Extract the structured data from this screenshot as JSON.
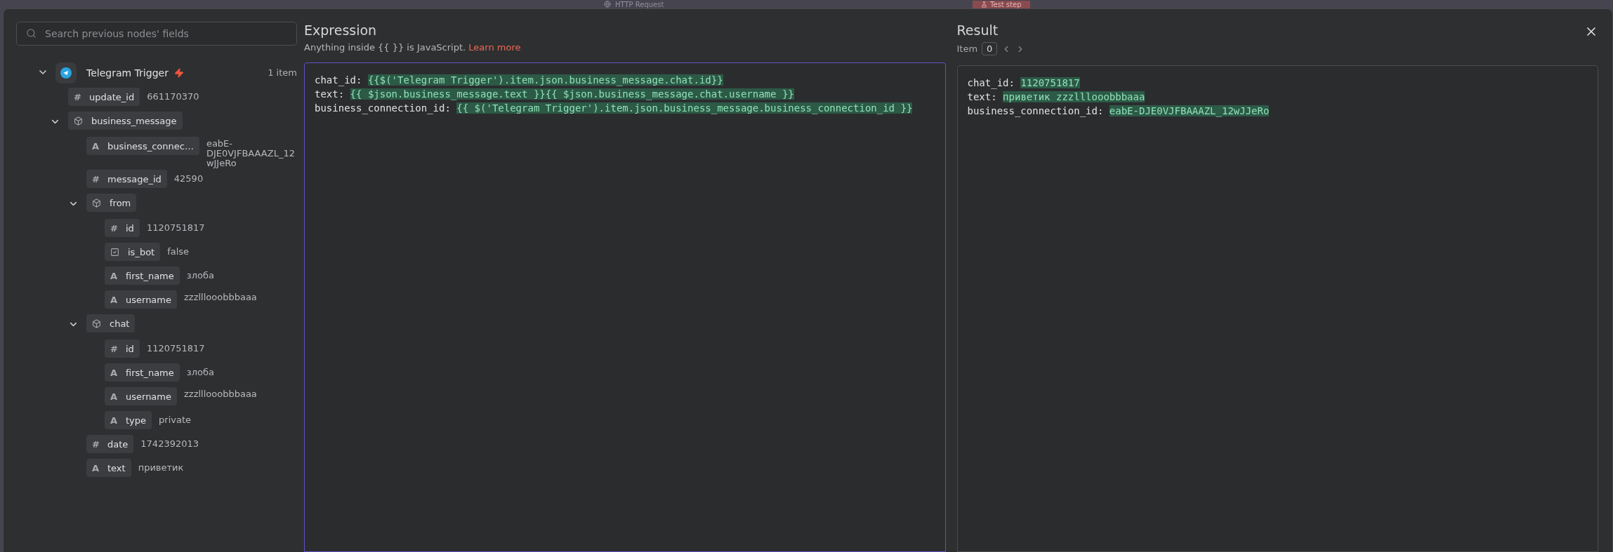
{
  "backdrop": {
    "node_label": "HTTP Request",
    "test_button": "Test step"
  },
  "search": {
    "placeholder": "Search previous nodes' fields"
  },
  "tree": [
    {
      "kind": "trigger",
      "name": "Telegram Trigger",
      "count": "1 item",
      "expanded": true,
      "children": [
        {
          "kind": "number",
          "glyph": "#",
          "key": "update_id",
          "value": "661170370"
        },
        {
          "kind": "object",
          "key": "business_message",
          "expanded": true,
          "children": [
            {
              "kind": "string",
              "glyph": "A",
              "key": "business_connec…",
              "value": "eabE-DJE0VJFBAAAZL_12wJJeRo"
            },
            {
              "kind": "number",
              "glyph": "#",
              "key": "message_id",
              "value": "42590"
            },
            {
              "kind": "object",
              "key": "from",
              "expanded": true,
              "children": [
                {
                  "kind": "number",
                  "glyph": "#",
                  "key": "id",
                  "value": "1120751817"
                },
                {
                  "kind": "boolean",
                  "key": "is_bot",
                  "value": "false"
                },
                {
                  "kind": "string",
                  "glyph": "A",
                  "key": "first_name",
                  "value": "злоба"
                },
                {
                  "kind": "string",
                  "glyph": "A",
                  "key": "username",
                  "value": "zzzlllooobbbaaa"
                }
              ]
            },
            {
              "kind": "object",
              "key": "chat",
              "expanded": true,
              "children": [
                {
                  "kind": "number",
                  "glyph": "#",
                  "key": "id",
                  "value": "1120751817"
                },
                {
                  "kind": "string",
                  "glyph": "A",
                  "key": "first_name",
                  "value": "злоба"
                },
                {
                  "kind": "string",
                  "glyph": "A",
                  "key": "username",
                  "value": "zzzlllooobbbaaa"
                },
                {
                  "kind": "string",
                  "glyph": "A",
                  "key": "type",
                  "value": "private"
                }
              ]
            },
            {
              "kind": "number",
              "glyph": "#",
              "key": "date",
              "value": "1742392013"
            },
            {
              "kind": "string",
              "glyph": "A",
              "key": "text",
              "value": "приветик"
            }
          ]
        }
      ]
    }
  ],
  "expression": {
    "title": "Expression",
    "hint": "Anything inside {{  }} is JavaScript.",
    "link": "Learn more",
    "focused": true,
    "lines": [
      {
        "label": "chat_id:",
        "segments": [
          "{{$('Telegram Trigger').item.json.business_message.chat.id}}"
        ]
      },
      {
        "label": "text:",
        "segments": [
          "{{ $json.business_message.text }}",
          "{{ $json.business_message.chat.username }}"
        ]
      },
      {
        "label": "business_connection_id:",
        "segments": [
          "{{ $('Telegram Trigger').item.json.business_message.business_connection_id }}"
        ]
      }
    ]
  },
  "result": {
    "title": "Result",
    "item_label": "Item",
    "item_index": "0",
    "lines": [
      {
        "label": "chat_id:",
        "segments": [
          "1120751817"
        ]
      },
      {
        "label": "text:",
        "segments": [
          "приветик zzzlllooobbbaaa"
        ]
      },
      {
        "label": "business_connection_id:",
        "segments": [
          "eabE-DJE0VJFBAAAZL_12wJJeRo"
        ]
      }
    ]
  }
}
